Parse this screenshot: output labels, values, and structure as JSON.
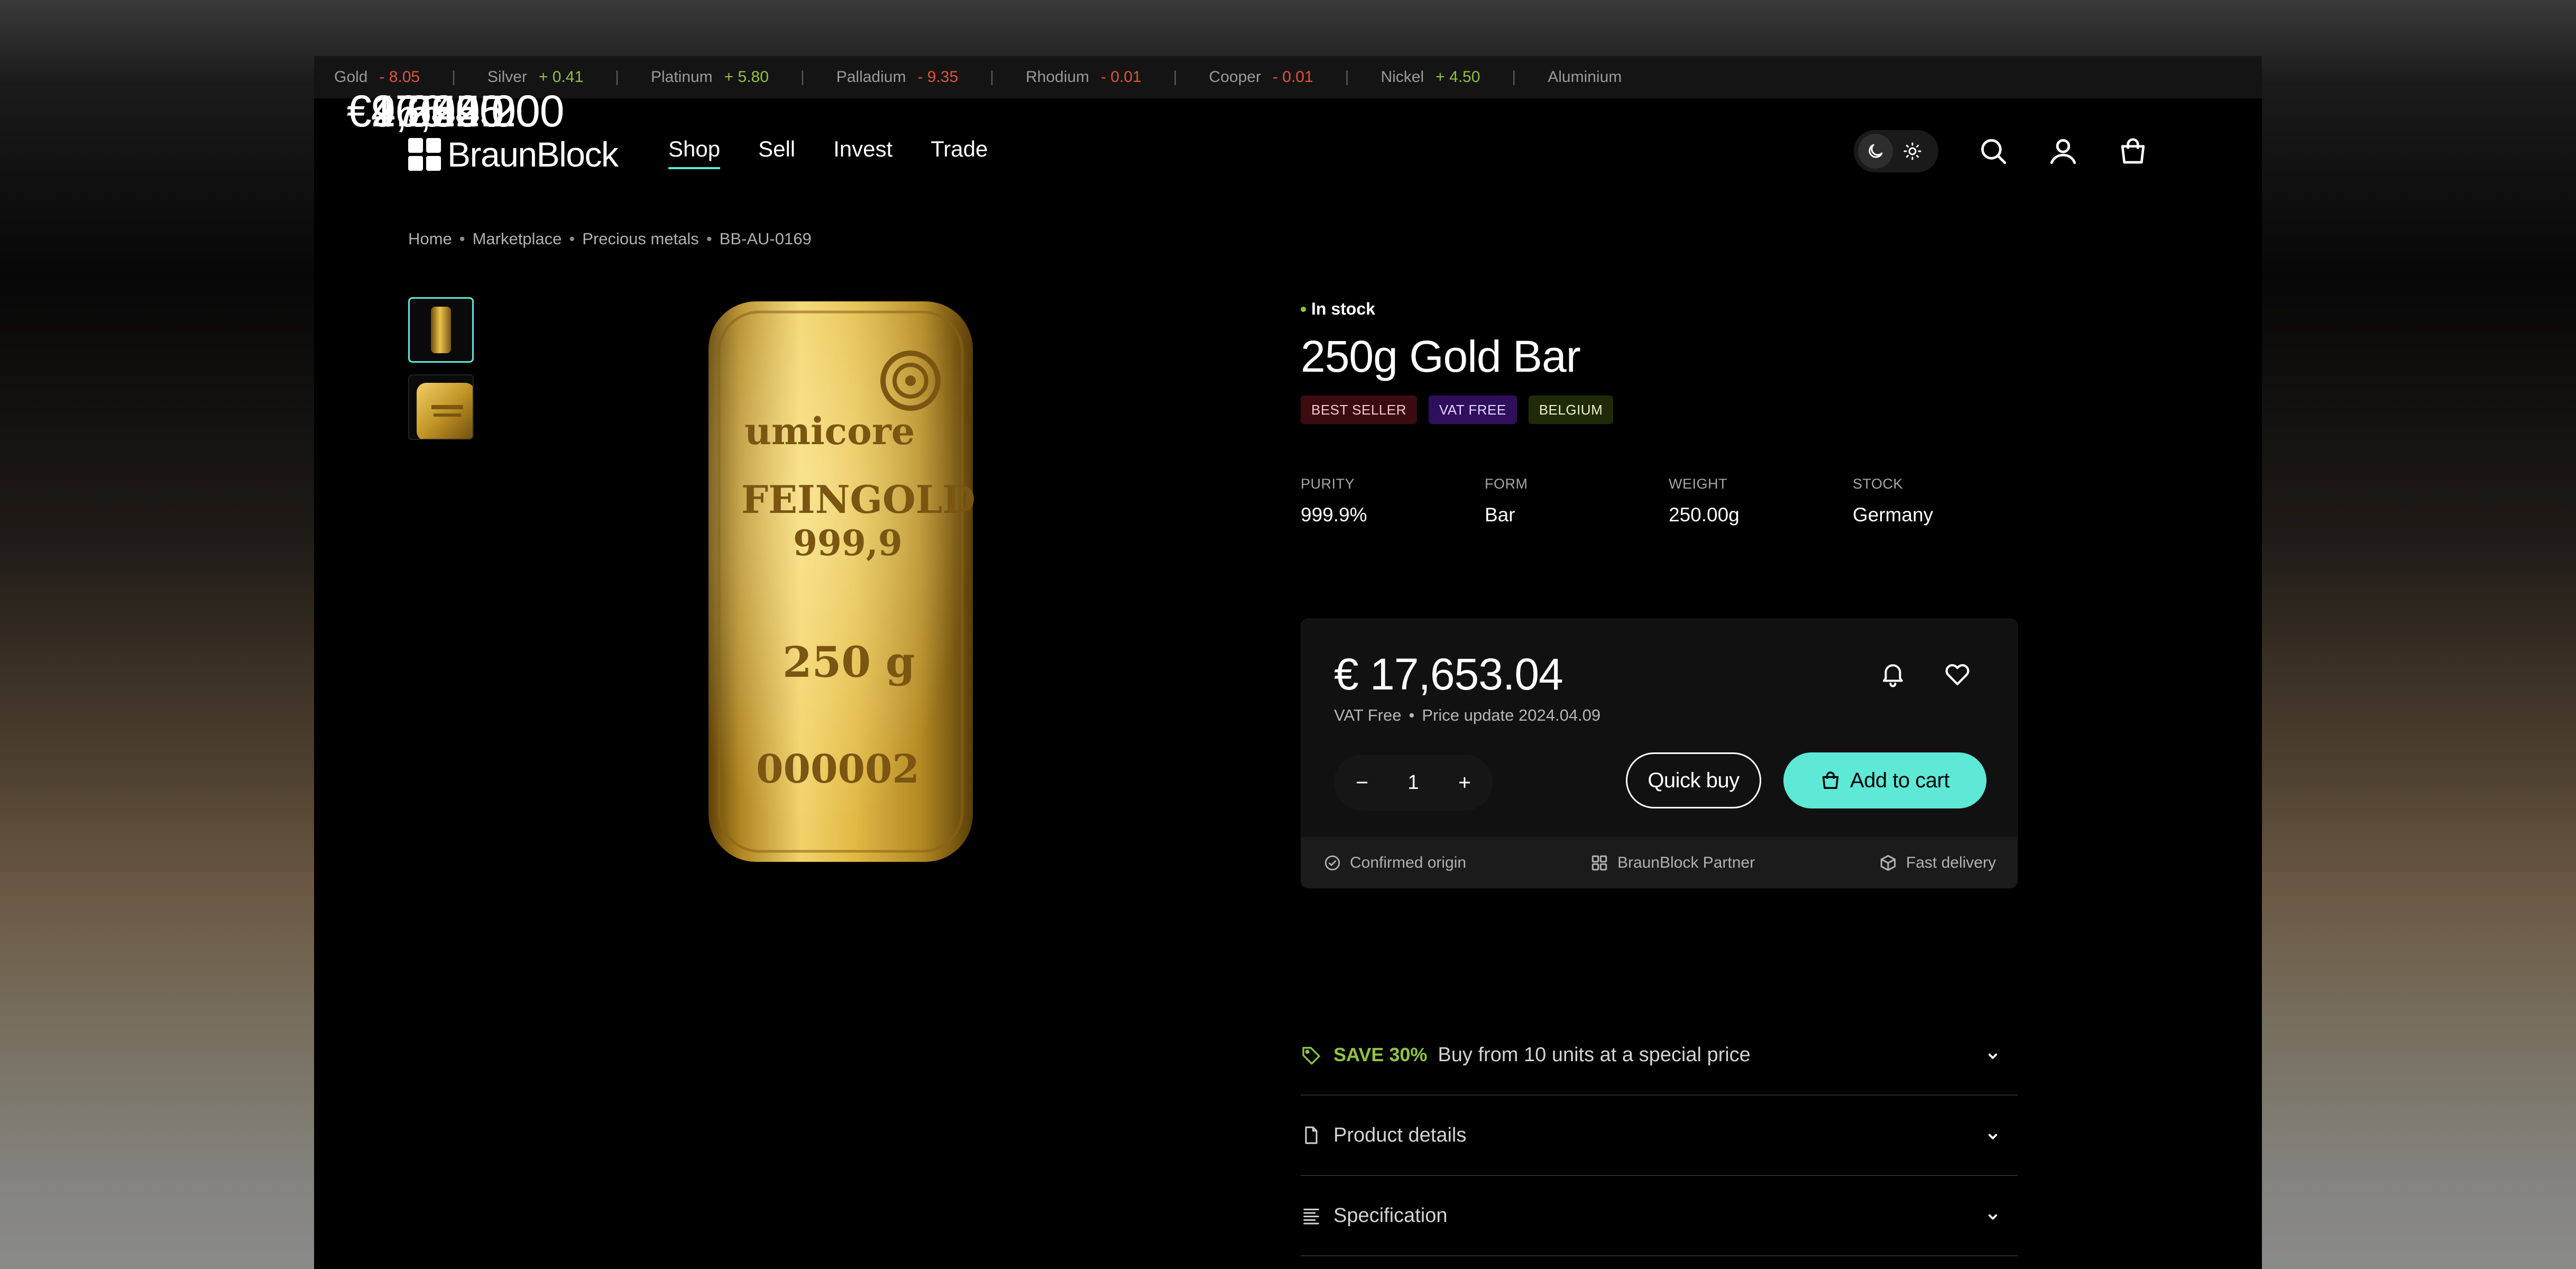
{
  "ticker": [
    {
      "name": "Gold",
      "price": "€2,629.00",
      "change": "- 8.05",
      "dir": "down"
    },
    {
      "name": "Silver",
      "price": "€26.40",
      "change": "+ 0.41",
      "dir": "up"
    },
    {
      "name": "Platinum",
      "price": "€976.40",
      "change": "+ 5.80",
      "dir": "up"
    },
    {
      "name": "Palladium",
      "price": "€1,255.20",
      "change": "- 9.35",
      "dir": "down"
    },
    {
      "name": "Rhodium",
      "price": "€4,525.00",
      "change": "- 0.01",
      "dir": "down"
    },
    {
      "name": "Cooper",
      "price": "€4.90",
      "change": "- 0.01",
      "dir": "down"
    },
    {
      "name": "Nickel",
      "price": "€16,825.00",
      "change": "+ 4.50",
      "dir": "up"
    },
    {
      "name": "Aluminium",
      "price": "€2,2",
      "change": "",
      "dir": "up"
    }
  ],
  "header": {
    "brand": "BraunBlock",
    "nav": [
      "Shop",
      "Sell",
      "Invest",
      "Trade"
    ],
    "active_nav": "Shop",
    "theme": "dark"
  },
  "breadcrumb": [
    "Home",
    "Marketplace",
    "Precious metals",
    "BB-AU-0169"
  ],
  "product": {
    "status": "In stock",
    "title": "250g Gold Bar",
    "badges": [
      "BEST SELLER",
      "VAT FREE",
      "BELGIUM"
    ],
    "specs": [
      {
        "label": "PURITY",
        "value": "999.9%"
      },
      {
        "label": "FORM",
        "value": "Bar"
      },
      {
        "label": "WEIGHT",
        "value": "250.00g"
      },
      {
        "label": "STOCK",
        "value": "Germany"
      }
    ],
    "bar_engraving": {
      "brand": "umicore",
      "line1": "FEINGOLD",
      "line2": "999,9",
      "weight": "250 g",
      "serial": "000002"
    }
  },
  "purchase": {
    "price": "€ 17,653.04",
    "vat_label": "VAT Free",
    "price_update": "Price update 2024.04.09",
    "quantity": "1",
    "quick_buy": "Quick buy",
    "add_to_cart": "Add to cart",
    "features": [
      "Confirmed origin",
      "BraunBlock Partner",
      "Fast delivery"
    ]
  },
  "accordions": {
    "save_highlight": "SAVE 30%",
    "save_text": "Buy from 10 units at a special price",
    "details": "Product details",
    "specification": "Specification"
  },
  "colors": {
    "accent": "#5ee8d6",
    "up": "#92c241",
    "down": "#e0533a",
    "background": "#000000"
  }
}
